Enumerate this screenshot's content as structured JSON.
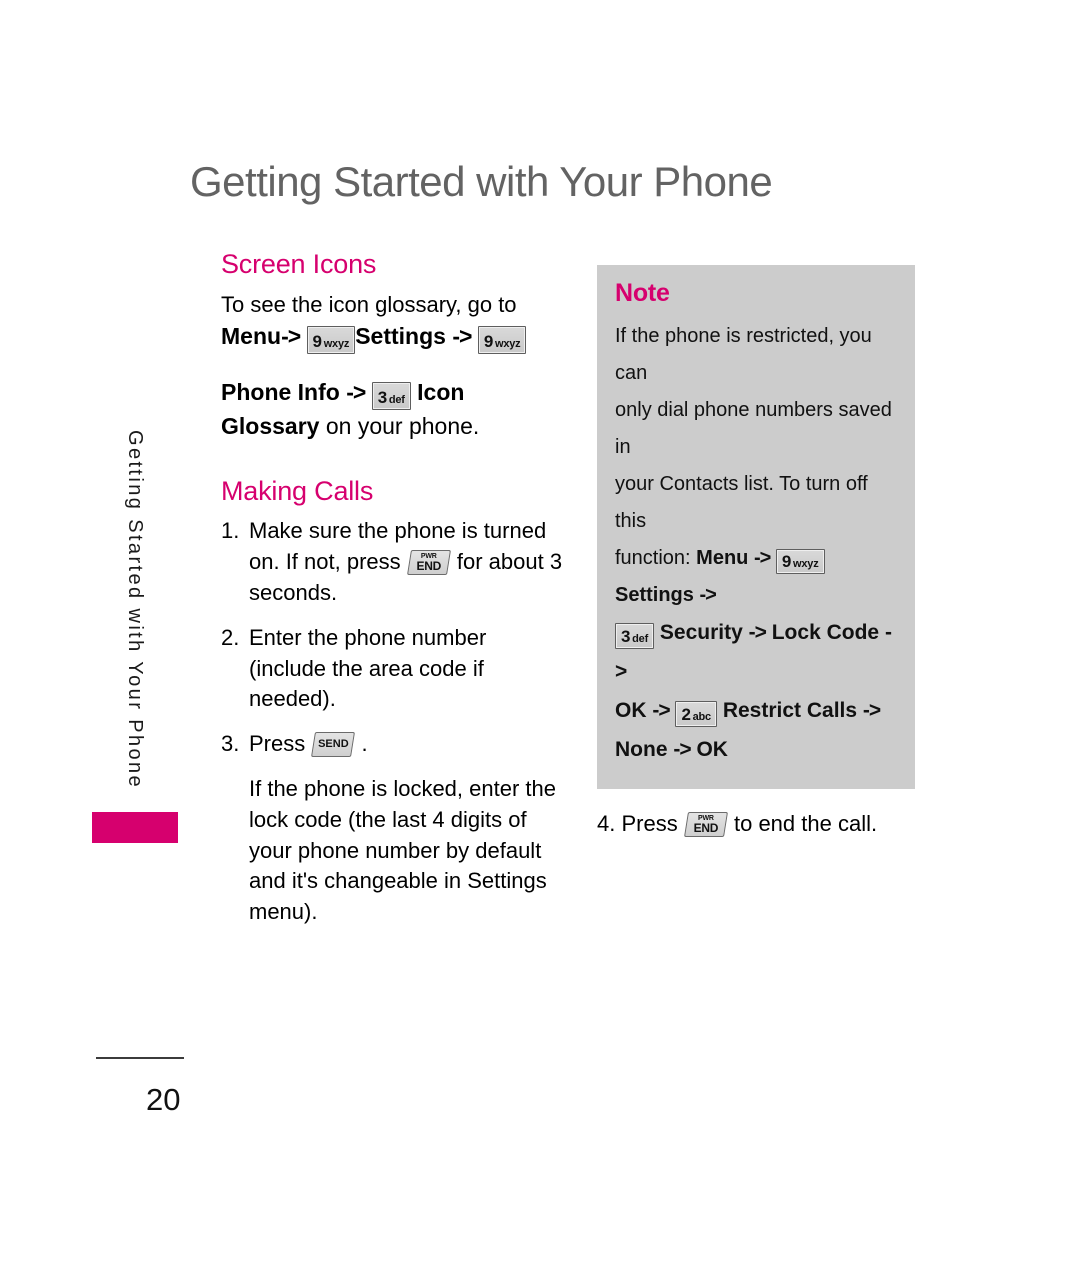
{
  "page": {
    "title": "Getting Started with Your Phone",
    "number": "20"
  },
  "side_tab": {
    "label": "Getting Started with Your Phone",
    "bar_color": "#d6006e"
  },
  "colors": {
    "accent_magenta": "#d6006e",
    "title_gray": "#636363",
    "note_background": "#cccccc",
    "key_face": "#d3d3d3"
  },
  "keys": {
    "nine_digit": "9",
    "nine_letters": "wxyz",
    "three_digit": "3",
    "three_letters": "def",
    "two_digit": "2",
    "two_letters": "abc",
    "end_top": "PWR",
    "end_main": "END",
    "send_main": "SEND"
  },
  "screen_icons": {
    "heading": "Screen Icons",
    "line1": "To see the icon glossary, go to",
    "menu_label": "Menu",
    "arrow": "->",
    "settings_label": "Settings",
    "phone_info_label": "Phone Info",
    "icon_label": "Icon",
    "glossary_label": "Glossary",
    "glossary_tail": "on your phone."
  },
  "making_calls": {
    "heading": "Making Calls",
    "steps": [
      {
        "num": "1.",
        "part1": "Make sure the phone is turned on. If not, press",
        "part2": "for about 3 seconds."
      },
      {
        "num": "2.",
        "part1": "Enter the phone number (include the area code if needed).",
        "part2": ""
      },
      {
        "num": "3.",
        "part1": "Press",
        "part2": "."
      }
    ],
    "locked_note": "If the phone is locked, enter the lock code (the last 4 digits of your phone number by default and it's changeable in Settings menu)."
  },
  "note": {
    "title": "Note",
    "line1": "If the phone is restricted, you can",
    "line2": "only dial phone numbers saved in",
    "line3": "your Contacts list. To turn off this",
    "line4_prefix": "function:",
    "line4_menu": "Menu",
    "line4_settings": "Settings",
    "line5_security": "Security",
    "line5_lockcode": "Lock Code",
    "line6_ok": "OK",
    "line6_restrict": "Restrict Calls",
    "line7_none": "None",
    "line7_ok": "OK",
    "arrow": "->"
  },
  "step_four": {
    "num": "4.",
    "part1": "Press",
    "part2": "to end the call."
  }
}
